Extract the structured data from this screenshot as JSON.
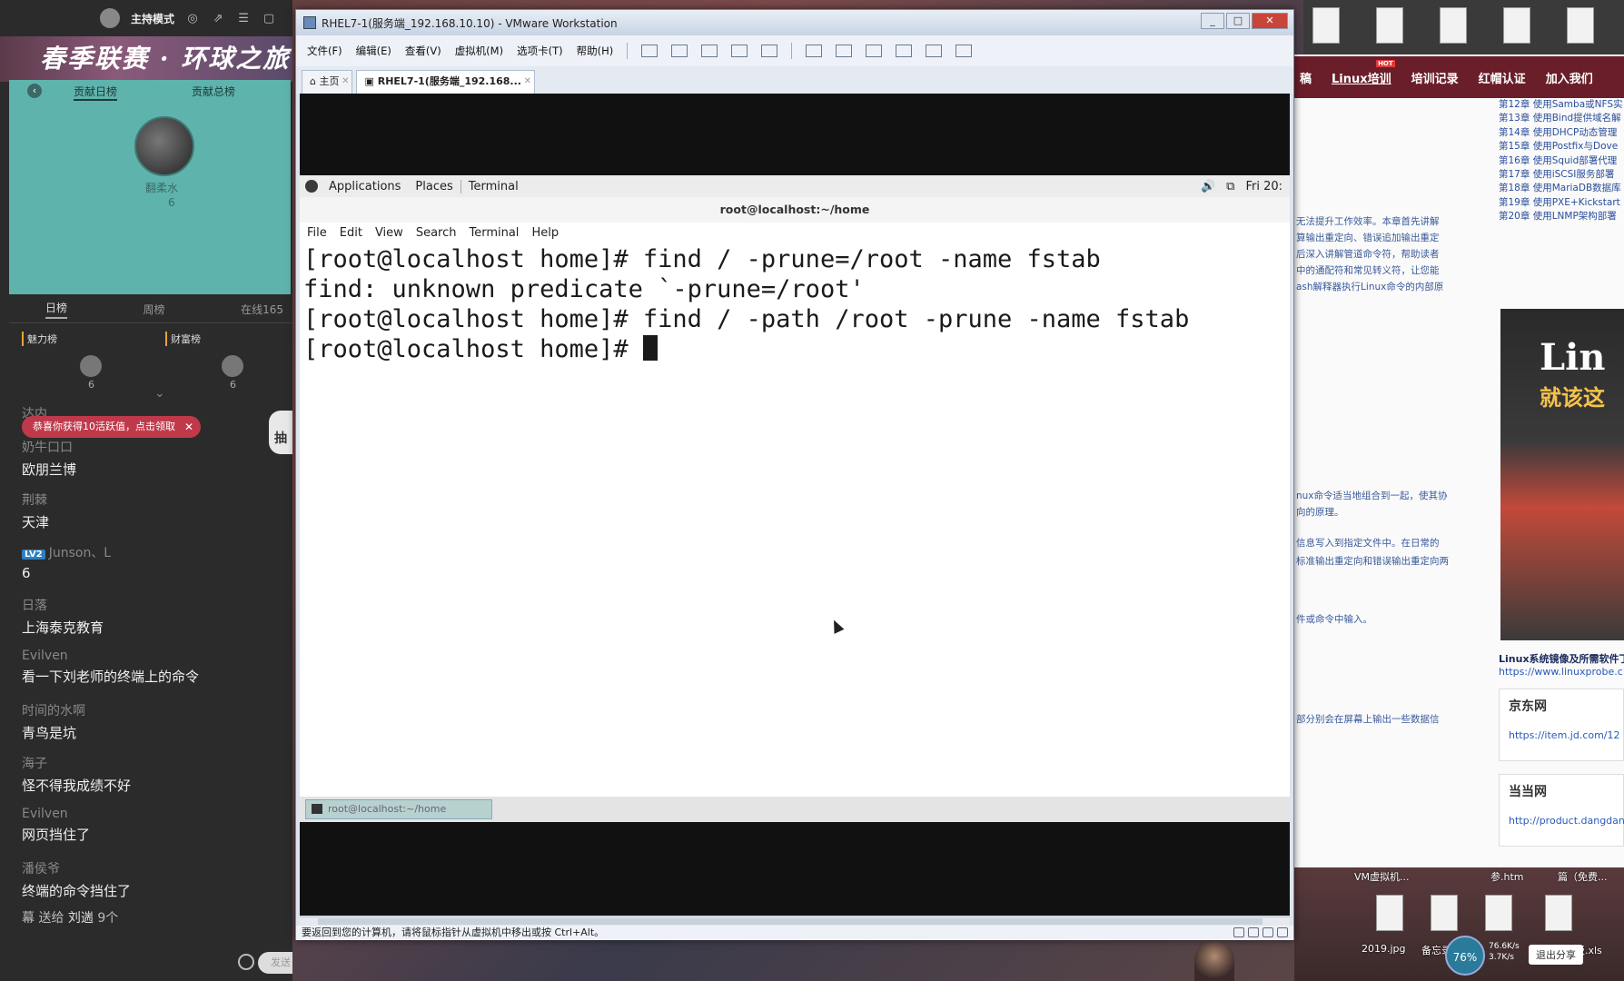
{
  "stream": {
    "mode_label": "主持模式",
    "banner_text": "春季联赛 · 环球之旅",
    "rank_tabs": [
      "贡献日榜",
      "贡献总榜"
    ],
    "top_fan": {
      "name": "翻柔水",
      "score": "6"
    },
    "period_tabs": [
      "日榜",
      "周榜"
    ],
    "online_count": "在线165",
    "lists": [
      {
        "label": "魅力榜",
        "score": "6"
      },
      {
        "label": "财富榜",
        "score": "6"
      }
    ],
    "gift_toast": "恭喜你获得10活跃值，点击领取",
    "lottery_label": "抽",
    "chat": [
      {
        "user": "达内",
        "text": ""
      },
      {
        "user": "奶牛口口",
        "text": "欧朋兰博"
      },
      {
        "user": "荆棘",
        "text": "天津"
      },
      {
        "user": "Junson、L",
        "text": "6",
        "level": "LV2"
      },
      {
        "user": "日落",
        "text": "上海泰克教育"
      },
      {
        "user": "Evilven",
        "text": "看一下刘老师的终端上的命令"
      },
      {
        "user": "时间的水啊",
        "text": "青鸟是坑"
      },
      {
        "user": "海子",
        "text": "怪不得我成绩不好"
      },
      {
        "user": "Evilven",
        "text": "网页挡住了"
      },
      {
        "user": "潘侯爷",
        "text": "终端的命令挡住了"
      }
    ],
    "gift_line": {
      "prefix": "幕 送给",
      "name": "刘遄",
      "count": "9个"
    },
    "send_label": "发送"
  },
  "vmware": {
    "title": "RHEL7-1(服务端_192.168.10.10) - VMware Workstation",
    "win_controls": [
      "_",
      "□",
      "✕"
    ],
    "menu": [
      "文件(F)",
      "编辑(E)",
      "查看(V)",
      "虚拟机(M)",
      "选项卡(T)",
      "帮助(H)"
    ],
    "tabs": [
      {
        "label": "主页"
      },
      {
        "label": "RHEL7-1(服务端_192.168..."
      }
    ],
    "status_text": "要返回到您的计算机，请将鼠标指针从虚拟机中移出或按 Ctrl+Alt。"
  },
  "gnome": {
    "applications": "Applications",
    "places": "Places",
    "terminal": "Terminal",
    "clock": "Fri 20:",
    "volume_icon": "speaker-icon"
  },
  "terminal": {
    "title": "root@localhost:~/home",
    "menu": [
      "File",
      "Edit",
      "View",
      "Search",
      "Terminal",
      "Help"
    ],
    "lines": [
      "[root@localhost home]# find / -prune=/root -name fstab",
      "find: unknown predicate `-prune=/root'",
      "[root@localhost home]# find / -path /root -prune -name fstab",
      "[root@localhost home]# "
    ],
    "taskbar_item": "root@localhost:~/home"
  },
  "browser": {
    "nav": [
      "稿",
      "Linux培训",
      "培训记录",
      "红帽认证",
      "加入我们"
    ],
    "hot_badge": "HOT",
    "toc": [
      "第12章 使用Samba或NFS实",
      "第13章 使用Bind提供域名解",
      "第14章 使用DHCP动态管理",
      "第15章 使用Postfix与Dove",
      "第16章 使用Squid部署代理",
      "第17章 使用iSCSI服务部署",
      "第18章 使用MariaDB数据库",
      "第19章 使用PXE+Kickstart",
      "第20章 使用LNMP架构部署"
    ],
    "snippets": [
      "无法提升工作效率。本章首先讲解",
      "算输出重定向、错误追加输出重定",
      "后深入讲解管道命令符，帮助读者",
      "中的通配符和常见转义符，让您能",
      "ash解释器执行Linux命令的内部原",
      "nux命令适当地组合到一起，使其协",
      "向的原理。",
      "信息写入到指定文件中。在日常的",
      "标准输出重定向和错误输出重定向两",
      "件或命令中输入。",
      "部分别会在屏幕上输出一些数据信"
    ],
    "book_title": "Lin",
    "book_subtitle": "就该这",
    "book_caption": "Linux系统镜像及所需软件丁",
    "book_url": "https://www.linuxprobe.c",
    "shops": [
      {
        "name": "京东网",
        "url": "https://item.jd.com/12"
      },
      {
        "name": "当当网",
        "url": "http://product.dangdan"
      }
    ],
    "desk_labels": [
      "VM虚拟机...",
      "参.htm",
      "篇（免费...",
      "2019.jpg",
      "备忘录",
      "文档模板.xls"
    ],
    "net_percent": "76%",
    "net_up": "76.6K/s",
    "net_down": "3.7K/s",
    "exit_share": "退出分享"
  }
}
